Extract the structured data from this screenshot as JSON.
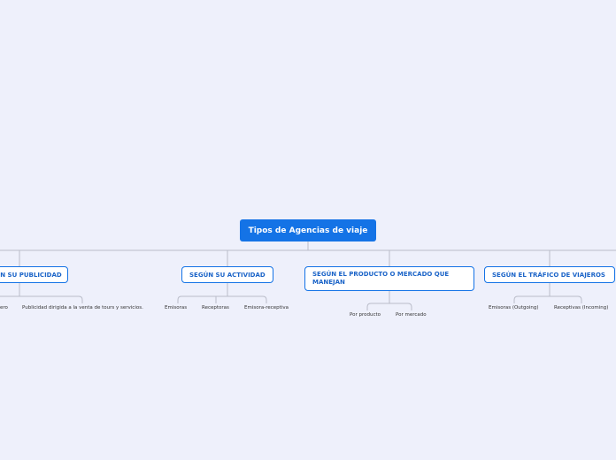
{
  "root": {
    "label": "Tipos de Agencias de viaje"
  },
  "branches": [
    {
      "label": "SEGÚN SU PUBLICIDAD",
      "children": [
        "ero",
        "Publicidad dirigida a la venta de tours y servicios."
      ]
    },
    {
      "label": "SEGÚN SU ACTIVIDAD",
      "children": [
        "Emisoras",
        "Receptoras",
        "Emisora-receptiva"
      ]
    },
    {
      "label": "SEGÚN EL PRODUCTO O MERCADO QUE MANEJAN",
      "children": [
        "Por producto",
        "Por mercado"
      ]
    },
    {
      "label": "SEGÚN EL TRÁFICO DE VIAJEROS",
      "children": [
        "Emisoras (Outgoing)",
        "Receptivas (Incoming)"
      ]
    }
  ],
  "colors": {
    "background": "#eef0fb",
    "root_fill": "#1473e6",
    "topic_border": "#1473e6",
    "topic_text": "#1b64c8",
    "connector": "#b9bcc8"
  }
}
